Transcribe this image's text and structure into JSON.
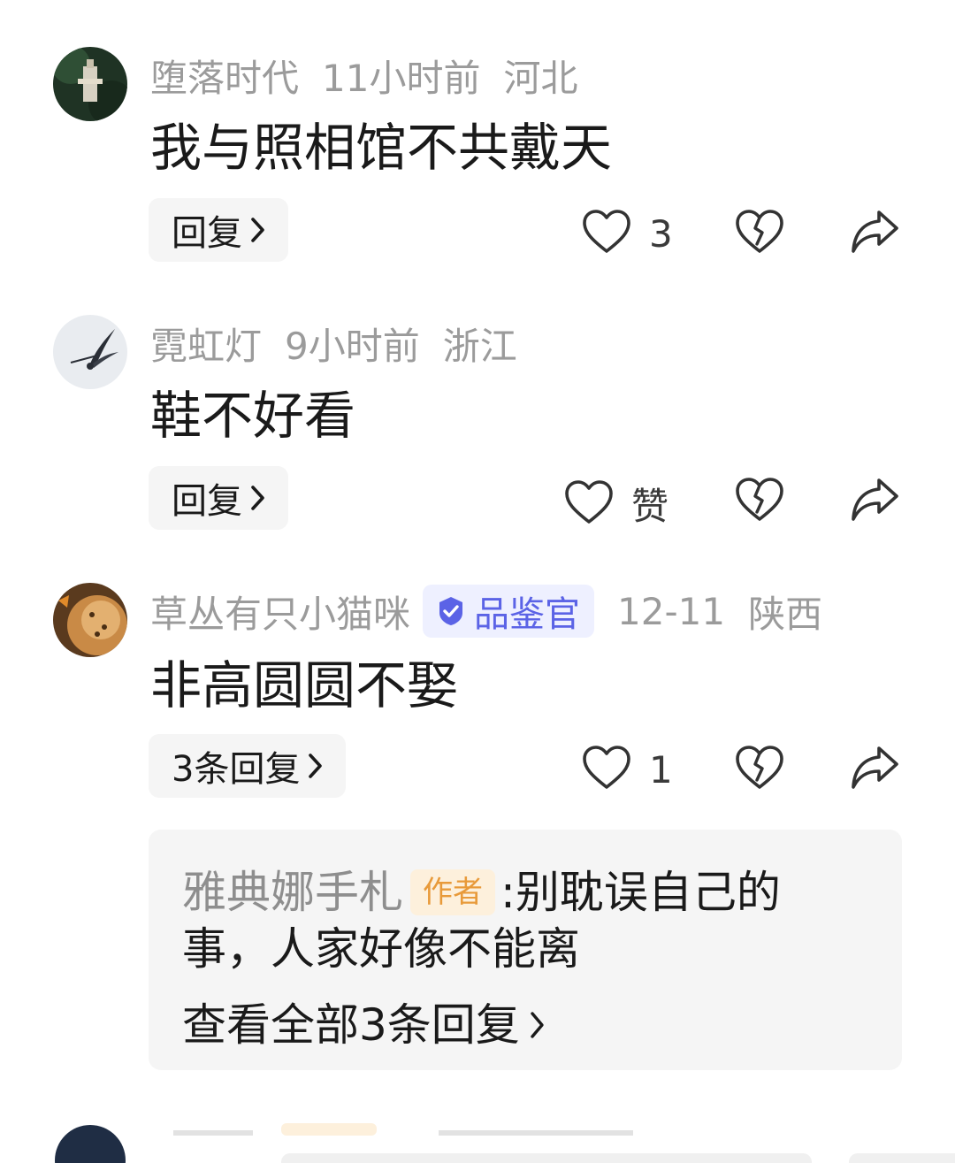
{
  "comments": [
    {
      "username": "堕落时代",
      "time": "11小时前",
      "location": "河北",
      "text": "我与照相馆不共戴天",
      "reply_label": "回复",
      "like_label": "3"
    },
    {
      "username": "霓虹灯",
      "time": "9小时前",
      "location": "浙江",
      "text": "鞋不好看",
      "reply_label": "回复",
      "like_label": "赞"
    },
    {
      "username": "草丛有只小猫咪",
      "badge": "品鉴官",
      "time": "12-11",
      "location": "陕西",
      "text": "非高圆圆不娶",
      "reply_label": "3条回复",
      "like_label": "1",
      "sub_reply": {
        "author": "雅典娜手札",
        "author_tag": "作者",
        "text_line1": ":别耽误自己的",
        "text_line2": "事，人家好像不能离",
        "view_all": "查看全部3条回复"
      }
    }
  ],
  "icons": {
    "like": "heart-outline-icon",
    "dislike": "broken-heart-icon",
    "share": "share-arrow-icon",
    "verified": "verified-check-icon",
    "chevron": "chevron-right-icon"
  },
  "colors": {
    "meta_text": "#9b9b9b",
    "badge_bg": "#eef0ff",
    "badge_text": "#5b63e6",
    "author_tag_bg": "#fdf0dc",
    "author_tag_text": "#e89a3a",
    "button_bg": "#f5f5f5"
  }
}
